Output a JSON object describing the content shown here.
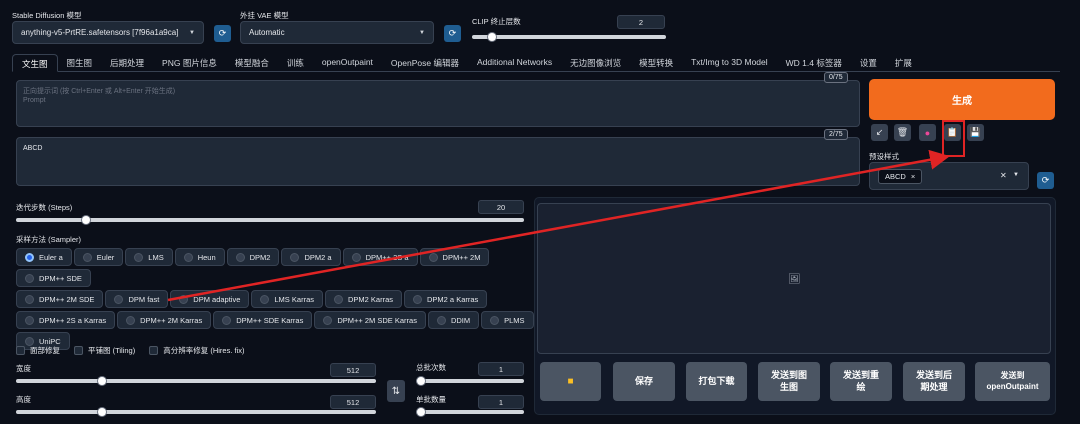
{
  "header": {
    "sd_model_label": "Stable Diffusion 模型",
    "sd_model_value": "anything-v5-PrtRE.safetensors [7f96a1a9ca]",
    "vae_label": "外挂 VAE 模型",
    "vae_value": "Automatic",
    "clip_label": "CLIP 终止层数",
    "clip_value": "2",
    "clip_level": 0.08
  },
  "tabs": [
    "文生图",
    "图生图",
    "后期处理",
    "PNG 图片信息",
    "模型融合",
    "训练",
    "openOutpaint",
    "OpenPose 编辑器",
    "Additional Networks",
    "无边图像浏览",
    "模型转换",
    "Txt/Img to 3D Model",
    "WD 1.4 标签器",
    "设置",
    "扩展"
  ],
  "prompt": {
    "placeholder_line1": "正向提示词 (按 Ctrl+Enter 或 Alt+Enter 开始生成)",
    "placeholder_line2": "Prompt",
    "counter": "0/75"
  },
  "negative": {
    "value": "ABCD",
    "counter": "2/75"
  },
  "generate": {
    "label": "生成",
    "tool_icons": [
      "arrow-icon",
      "trash-icon",
      "art-icon",
      "clipboard-icon",
      "save-icon"
    ],
    "styles_label": "预设样式",
    "style_tag": "ABCD"
  },
  "steps": {
    "label": "迭代步数 (Steps)",
    "value": "20",
    "level": 0.13
  },
  "sampler": {
    "label": "采样方法 (Sampler)",
    "row1": [
      "Euler a",
      "Euler",
      "LMS",
      "Heun",
      "DPM2",
      "DPM2 a",
      "DPM++ 2S a",
      "DPM++ 2M",
      "DPM++ SDE"
    ],
    "row2": [
      "DPM++ 2M SDE",
      "DPM fast",
      "DPM adaptive",
      "LMS Karras",
      "DPM2 Karras",
      "DPM2 a Karras"
    ],
    "row3": [
      "DPM++ 2S a Karras",
      "DPM++ 2M Karras",
      "DPM++ SDE Karras",
      "DPM++ 2M SDE Karras",
      "DDIM",
      "PLMS"
    ],
    "row4": [
      "UniPC"
    ],
    "selected": "Euler a"
  },
  "checks": [
    "面部修复",
    "平铺图 (Tiling)",
    "高分辨率修复 (Hires. fix)"
  ],
  "width": {
    "label": "宽度",
    "value": "512",
    "level": 0.23
  },
  "height": {
    "label": "高度",
    "value": "512",
    "level": 0.23
  },
  "swap_icon": "⇅",
  "batch_count": {
    "label": "总批次数",
    "value": "1",
    "level": 0.0
  },
  "batch_size": {
    "label": "单批数量",
    "value": "1",
    "level": 0.0
  },
  "actions": {
    "folder_icon": "folder-icon",
    "save": "保存",
    "zip": "打包下载",
    "to_img2img": "发送到图生图",
    "to_inpaint": "发送到重绘",
    "to_extras": "发送到后期处理",
    "to_outpaint": "发送到openOutpaint"
  },
  "colors": {
    "accent_orange": "#f26b1d",
    "highlight_red": "#e02424",
    "refresh_blue": "#1f5d91"
  }
}
